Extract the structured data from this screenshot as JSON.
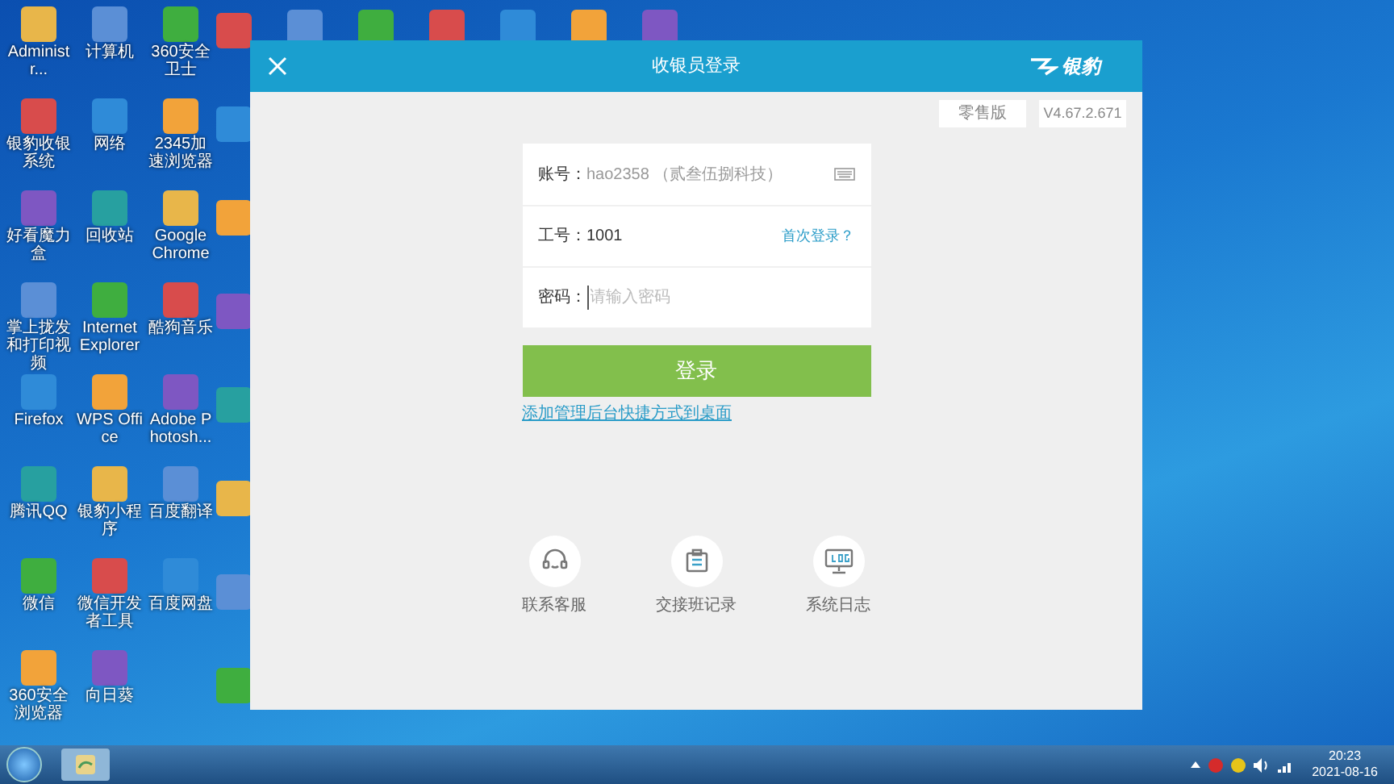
{
  "desktop_icons": [
    {
      "label": "Administr..."
    },
    {
      "label": "计算机"
    },
    {
      "label": "360安全卫士"
    },
    {
      "label": "银豹收银系统"
    },
    {
      "label": "网络"
    },
    {
      "label": "2345加速浏览器"
    },
    {
      "label": "好看魔力盒"
    },
    {
      "label": "回收站"
    },
    {
      "label": "Google Chrome"
    },
    {
      "label": "掌上拢发和打印视频"
    },
    {
      "label": "Internet Explorer"
    },
    {
      "label": "酷狗音乐"
    },
    {
      "label": "Firefox"
    },
    {
      "label": "WPS Office"
    },
    {
      "label": "Adobe Photosh..."
    },
    {
      "label": "腾讯QQ"
    },
    {
      "label": "银豹小程序"
    },
    {
      "label": "百度翻译"
    },
    {
      "label": "微信"
    },
    {
      "label": "微信开发者工具"
    },
    {
      "label": "百度网盘"
    },
    {
      "label": "360安全浏览器"
    },
    {
      "label": "向日葵"
    }
  ],
  "window": {
    "title": "收银员登录",
    "brand": "银豹",
    "edition": "零售版",
    "version": "V4.67.2.671"
  },
  "form": {
    "fields": [
      {
        "label": "账号：",
        "value": "hao2358 （贰叁伍捌科技）",
        "kind": "keyboard"
      },
      {
        "label": "工号：",
        "value": "1001",
        "kind": "link",
        "link": "首次登录？"
      },
      {
        "label": "密码：",
        "placeholder": "请输入密码",
        "kind": "password"
      }
    ],
    "submit": "登录",
    "shortcut_link": "添加管理后台快捷方式到桌面"
  },
  "tools": [
    {
      "label": "联系客服",
      "kind": "support"
    },
    {
      "label": "交接班记录",
      "kind": "handover"
    },
    {
      "label": "系统日志",
      "kind": "log"
    }
  ],
  "taskbar": {
    "time": "20:23",
    "date": "2021-08-16"
  }
}
